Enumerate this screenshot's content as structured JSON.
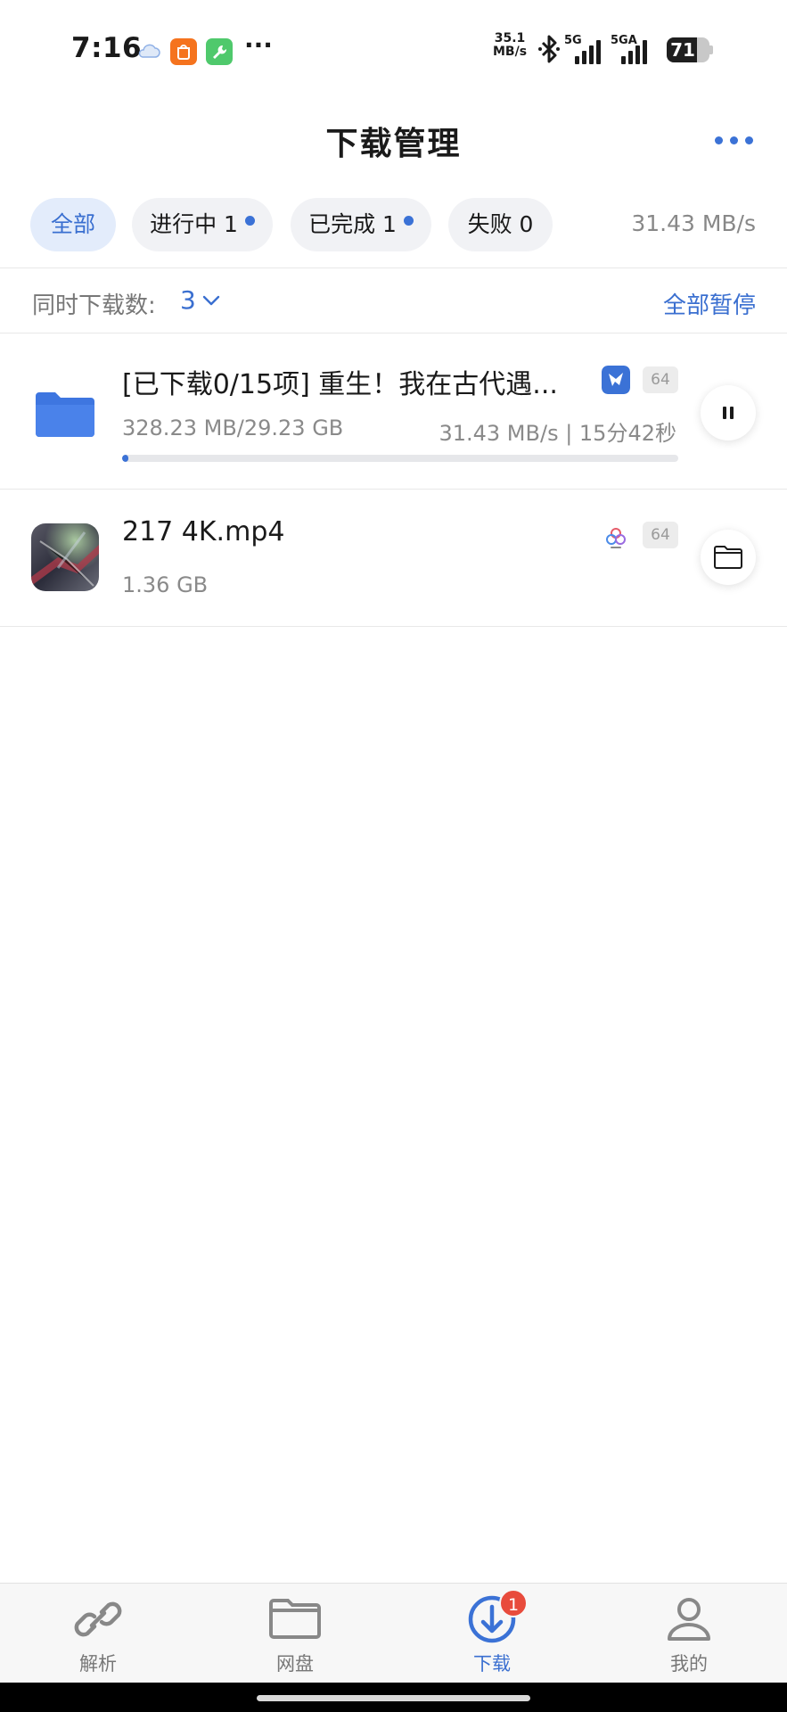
{
  "status_bar": {
    "time": "7:16",
    "more": "···",
    "net_speed_value": "35.1",
    "net_speed_unit": "MB/s",
    "sim1_label": "5G",
    "sim2_label": "5GA",
    "battery_percent": "71",
    "battery_level": 0.71
  },
  "header": {
    "title": "下载管理"
  },
  "filters": {
    "tabs": [
      {
        "label": "全部",
        "active": true
      },
      {
        "label": "进行中 1",
        "dot": true
      },
      {
        "label": "已完成 1",
        "dot": true
      },
      {
        "label": "失败 0"
      }
    ],
    "total_speed": "31.43 MB/s"
  },
  "concurrency": {
    "label": "同时下载数:",
    "value": "3",
    "pause_all": "全部暂停"
  },
  "downloads": [
    {
      "title": "[已下载0/15项] 重生！我在古代遇...",
      "size": "328.23 MB/29.23 GB",
      "speed": "31.43 MB/s | 15分42秒",
      "badge": "64",
      "progress": 0.011,
      "action": "pause"
    },
    {
      "title": "217 4K.mp4",
      "size": "1.36 GB",
      "badge": "64",
      "action": "open-folder"
    }
  ],
  "bottom_nav": {
    "items": [
      {
        "label": "解析",
        "icon": "link-icon"
      },
      {
        "label": "网盘",
        "icon": "folder-icon"
      },
      {
        "label": "下载",
        "icon": "download-icon",
        "active": true,
        "badge": "1"
      },
      {
        "label": "我的",
        "icon": "user-icon"
      }
    ]
  },
  "colors": {
    "accent": "#3b72d6",
    "badge_red": "#e84b3c",
    "muted_text": "#8a8a8a"
  }
}
